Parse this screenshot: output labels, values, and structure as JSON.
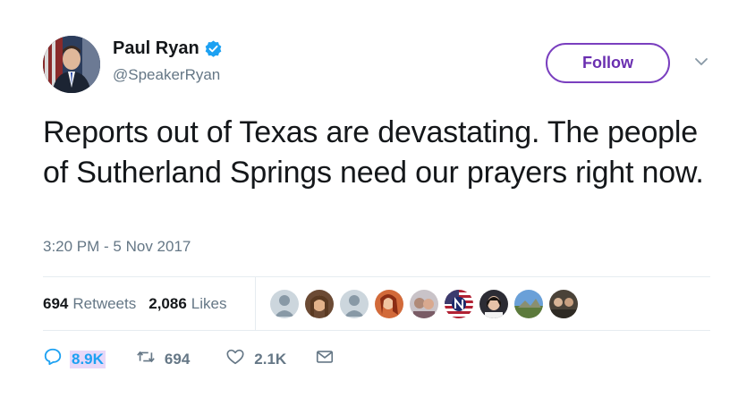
{
  "author": {
    "name": "Paul Ryan",
    "handle": "@SpeakerRyan",
    "verified": true
  },
  "follow_button": {
    "label": "Follow"
  },
  "tweet": {
    "text": "Reports out of Texas are devastating. The people of Sutherland Springs need our prayers right now.",
    "timestamp": "3:20 PM - 5 Nov 2017"
  },
  "stats": {
    "retweets_count": "694",
    "retweets_label": "Retweets",
    "likes_count": "2,086",
    "likes_label": "Likes"
  },
  "liker_avatars": [
    "default-avatar",
    "photo-avatar",
    "default-avatar",
    "photo-avatar",
    "photo-avatar",
    "flag-avatar",
    "photo-avatar",
    "photo-avatar",
    "photo-avatar"
  ],
  "actions": {
    "reply_count": "8.9K",
    "retweet_count": "694",
    "like_count": "2.1K"
  },
  "colors": {
    "follow_border": "#7a3fbf",
    "verified_blue": "#1da1f2",
    "muted_text": "#657786"
  }
}
